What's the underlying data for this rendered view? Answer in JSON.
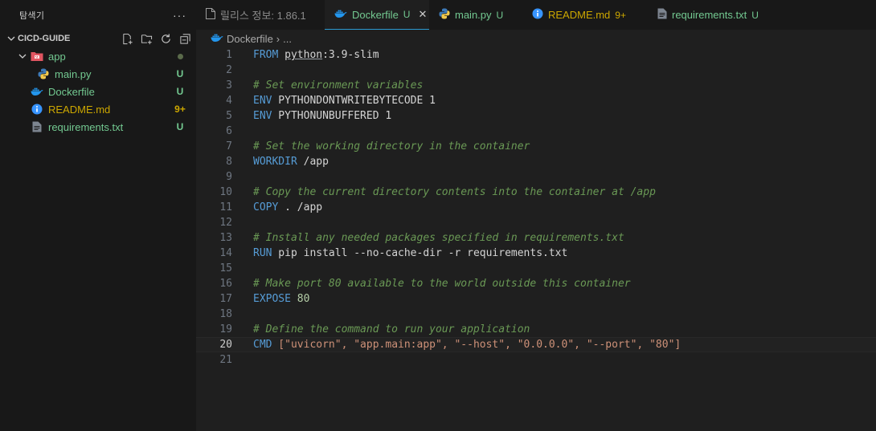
{
  "explorer": {
    "title": "탐색기",
    "more": "···",
    "section": "CICD-GUIDE",
    "items": [
      {
        "label": "app",
        "badge": "",
        "indent": 1
      },
      {
        "label": "main.py",
        "badge": "U"
      },
      {
        "label": "Dockerfile",
        "badge": "U"
      },
      {
        "label": "README.md",
        "badge": "9+"
      },
      {
        "label": "requirements.txt",
        "badge": "U"
      }
    ]
  },
  "tabs": [
    {
      "label": "릴리스 정보: 1.86.1",
      "flag": ""
    },
    {
      "label": "Dockerfile",
      "flag": "U",
      "close": "✕"
    },
    {
      "label": "main.py",
      "flag": "U"
    },
    {
      "label": "README.md",
      "flag": "9+"
    },
    {
      "label": "requirements.txt",
      "flag": "U"
    }
  ],
  "breadcrumb": {
    "file": "Dockerfile",
    "sep": "›",
    "more": "..."
  },
  "code": {
    "line_numbers": [
      "1",
      "2",
      "3",
      "4",
      "5",
      "6",
      "7",
      "8",
      "9",
      "10",
      "11",
      "12",
      "13",
      "14",
      "15",
      "16",
      "17",
      "18",
      "19",
      "20",
      "21"
    ],
    "l1_kw": "FROM",
    "l1_img": "python",
    "l1_rest": ":3.9-slim",
    "l3": "# Set environment variables",
    "l4_kw": "ENV",
    "l4_rest": " PYTHONDONTWRITEBYTECODE ",
    "l4_num": "1",
    "l5_kw": "ENV",
    "l5_rest": " PYTHONUNBUFFERED ",
    "l5_num": "1",
    "l7": "# Set the working directory in the container",
    "l8_kw": "WORKDIR",
    "l8_rest": " /app",
    "l10": "# Copy the current directory contents into the container at /app",
    "l11_kw": "COPY",
    "l11_rest": " . /app",
    "l13": "# Install any needed packages specified in requirements.txt",
    "l14_kw": "RUN",
    "l14_rest": " pip install --no-cache-dir -r requirements.txt",
    "l16": "# Make port 80 available to the world outside this container",
    "l17_kw": "EXPOSE",
    "l17_num": " 80",
    "l19": "# Define the command to run your application",
    "l20_kw": "CMD",
    "l20_rest": " [\"uvicorn\", \"app.main:app\", \"--host\", \"0.0.0.0\", \"--port\", \"80\"]"
  },
  "colors": {
    "accent": "#2b9bd1",
    "untracked": "#73c991",
    "warning": "#cca700"
  }
}
